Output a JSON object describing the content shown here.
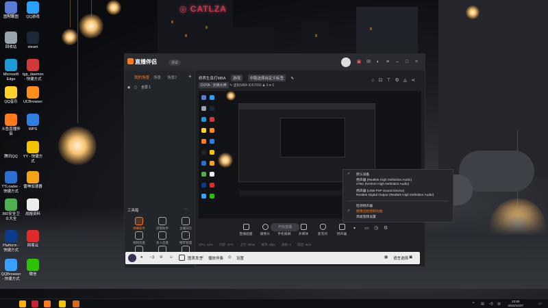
{
  "desktop_icons": [
    {
      "label": "图标截图",
      "color": "#5a7bd8"
    },
    {
      "label": "QQ游戏",
      "color": "#2aa1ff"
    },
    {
      "label": "6XC",
      "color": "#888"
    },
    {
      "label": "回收站",
      "color": "#9aa3ad"
    },
    {
      "label": "steam",
      "color": "#1b2838"
    },
    {
      "label": "Microsoft Edge",
      "color": "#1d9bd8"
    },
    {
      "label": "tgp_daemon - 快捷方式",
      "color": "#d23a3a"
    },
    {
      "label": "QQ音乐",
      "color": "#ffd32a"
    },
    {
      "label": "UCBrowser",
      "color": "#ff8d1a"
    },
    {
      "label": "斗鱼直播伴侣",
      "color": "#ff7a1a"
    },
    {
      "label": "WPS",
      "color": "#2e7fe1"
    },
    {
      "label": "腾讯QQ",
      "color": "#111"
    },
    {
      "label": "YY - 快捷方式",
      "color": "#f5c400"
    },
    {
      "label": "TTLoader - 快捷方式",
      "color": "#2b6fd1"
    },
    {
      "label": "雷神加速器",
      "color": "#f2a51a"
    },
    {
      "label": "360安全卫士大全",
      "color": "#4fae4f"
    },
    {
      "label": "战报资料",
      "color": "#ececec"
    },
    {
      "label": "Platform - 快捷方式",
      "color": "#0b3c8c"
    },
    {
      "label": "网易云",
      "color": "#e02b2b"
    },
    {
      "label": "QQBrowser - 快捷方式",
      "color": "#3aa0ff"
    },
    {
      "label": "微信",
      "color": "#2dc100"
    }
  ],
  "window": {
    "app_name": "直播伴侣",
    "version_badge": "测试",
    "tabs": [
      "我的场景",
      "场景",
      "场景2"
    ],
    "scene_item": "全屏 1",
    "tools_heading": "工具箱",
    "tools": [
      {
        "label": "弹幕助手",
        "hot": true
      },
      {
        "label": "房管助手",
        "hot": false
      },
      {
        "label": "主播日历",
        "hot": false
      },
      {
        "label": "视频连麦",
        "hot": false
      },
      {
        "label": "多人连麦",
        "hot": false
      },
      {
        "label": "推荐管理",
        "hot": false
      },
      {
        "label": "送弹幕",
        "hot": false
      },
      {
        "label": "虚拟形象",
        "hot": false
      },
      {
        "label": "弹幕库",
        "hot": false
      }
    ],
    "hint": "如何把手机游戏画面推上去？",
    "info_title": "修养生息打MBA",
    "info_chip1": "游戏",
    "info_chip2": "中路选择自定义标签",
    "info_row2": [
      "DOTA · 天梯大神",
      "虚拟MBA",
      "ID57000",
      "0",
      "0"
    ],
    "controls": [
      "直播画面",
      "摄像头",
      "手机投屏",
      "多媒体",
      "麦克风",
      "扬声器"
    ],
    "start_label": "开始直播",
    "status": [
      "CPU: 16%",
      "内存: 27%",
      "上行: 0kb/s",
      "帧率: 0fps",
      "丢帧: 0",
      "延迟: 0ms"
    ]
  },
  "audio_menu": {
    "items": [
      {
        "label": "默认设备",
        "checked": true,
        "orange": false
      },
      {
        "label": "扬声器 (Realtek High Definition Audio)",
        "checked": false,
        "orange": false
      },
      {
        "label": "27B1 (NVIDIA High Definition Audio)",
        "checked": false,
        "orange": false
      },
      {
        "label": "扬声器 (USB PnP Sound Device)",
        "checked": false,
        "orange": false
      },
      {
        "label": "Realtek Digital Output (Realtek High Definition Audio)",
        "checked": false,
        "orange": false
      },
      {
        "label": "检测扬声器",
        "checked": false,
        "orange": false
      },
      {
        "label": "使用远程控制功能",
        "checked": true,
        "orange": true
      },
      {
        "label": "高级音频设置",
        "checked": false,
        "orange": false
      }
    ]
  },
  "comment_bar": {
    "items": [
      "图表发言",
      "播放伴奏",
      "设置"
    ],
    "right_label": "语言选择"
  },
  "taskbar": {
    "time": "23:50",
    "date": "2022/10/27",
    "ime": "中"
  }
}
